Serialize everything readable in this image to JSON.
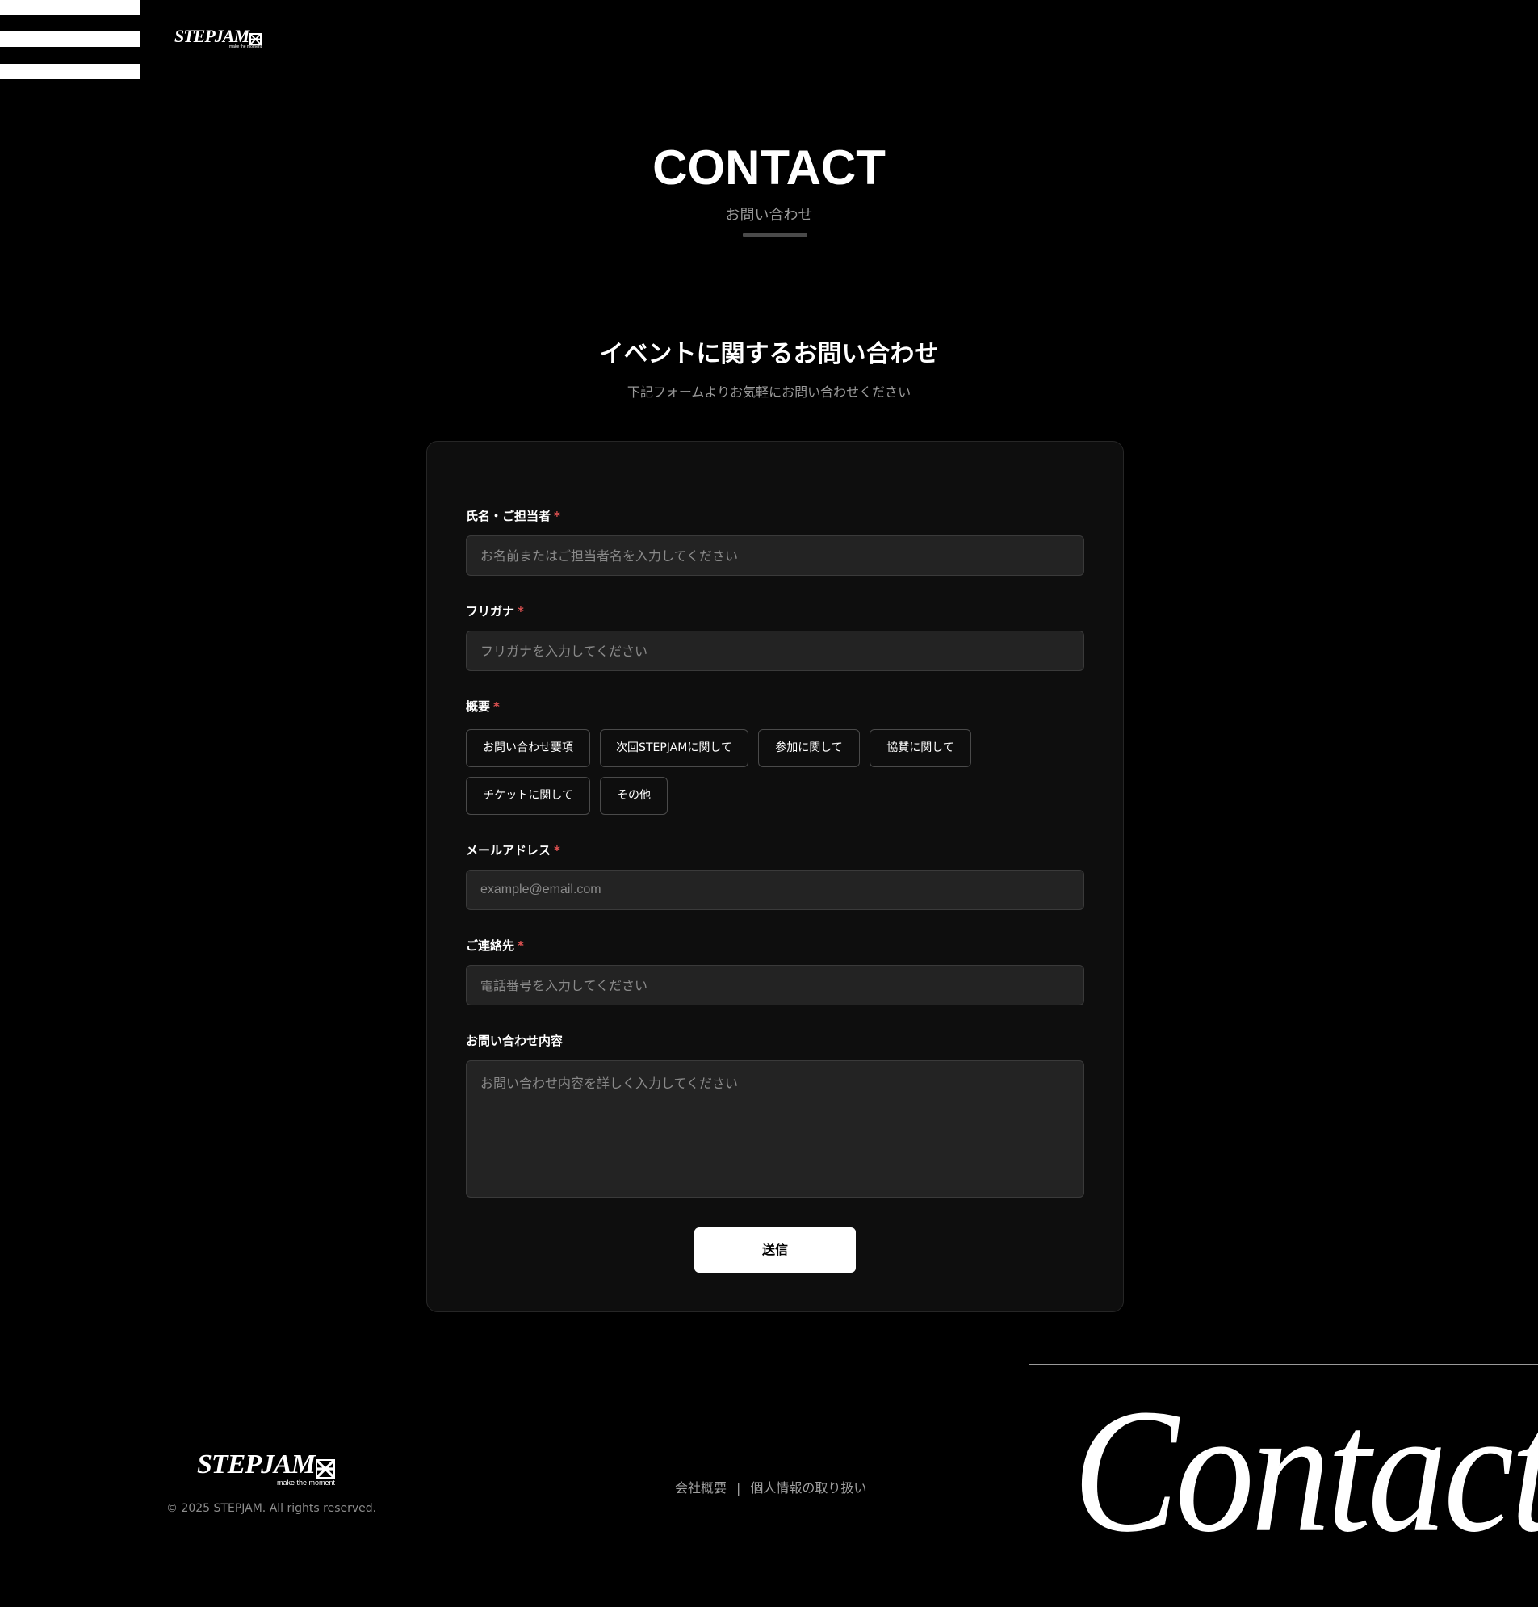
{
  "header": {
    "logo_text": "STEPJAM",
    "logo_tagline": "make the moment"
  },
  "hero": {
    "title": "CONTACT",
    "subtitle": "お問い合わせ"
  },
  "section": {
    "title": "イベントに関するお問い合わせ",
    "description": "下記フォームよりお気軽にお問い合わせください"
  },
  "form": {
    "name": {
      "label": "氏名・ご担当者",
      "required_mark": "*",
      "value": "",
      "placeholder": "お名前またはご担当者名を入力してください"
    },
    "furigana": {
      "label": "フリガナ",
      "required_mark": "*",
      "value": "",
      "placeholder": "フリガナを入力してください"
    },
    "summary": {
      "label": "概要",
      "required_mark": "*",
      "options": [
        "お問い合わせ要項",
        "次回STEPJAMに関して",
        "参加に関して",
        "協賛に関して",
        "チケットに関して",
        "その他"
      ]
    },
    "email": {
      "label": "メールアドレス",
      "required_mark": "*",
      "value": "",
      "placeholder": "example@email.com"
    },
    "phone": {
      "label": "ご連絡先",
      "required_mark": "*",
      "value": "",
      "placeholder": "電話番号を入力してください"
    },
    "message": {
      "label": "お問い合わせ内容",
      "value": "",
      "placeholder": "お問い合わせ内容を詳しく入力してください"
    },
    "submit_label": "送信"
  },
  "footer": {
    "logo_text": "STEPJAM",
    "logo_tagline": "make the moment",
    "copyright": "© 2025 STEPJAM. All rights reserved.",
    "links": [
      "会社概要",
      "個人情報の取り扱い"
    ],
    "separator": "|",
    "decorative_heading": "Contact"
  },
  "colors": {
    "background": "#000000",
    "card": "#0e0e0e",
    "input": "#232323",
    "required": "#e05252",
    "muted_text": "#9a9a9a"
  }
}
